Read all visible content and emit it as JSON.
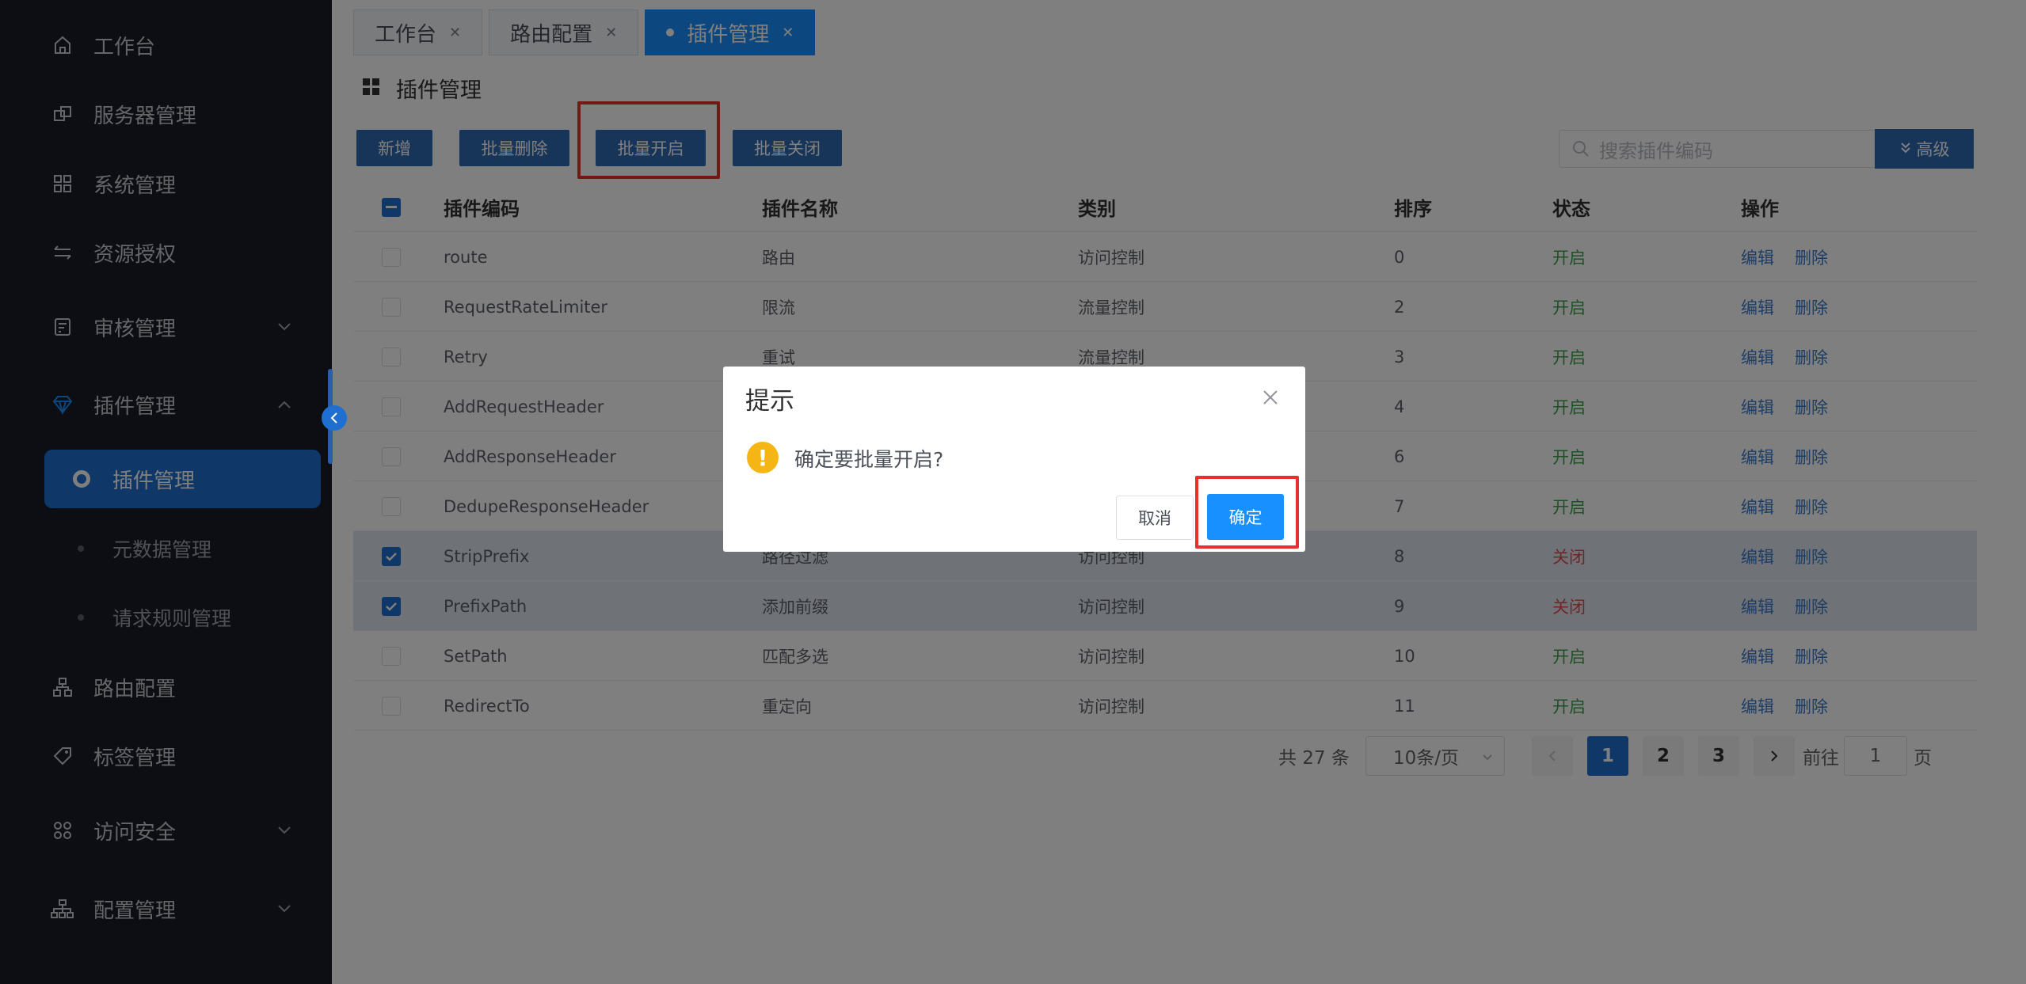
{
  "sidebar": {
    "items": [
      {
        "label": "工作台",
        "icon": "home-icon"
      },
      {
        "label": "服务器管理",
        "icon": "server-icon"
      },
      {
        "label": "系统管理",
        "icon": "grid-icon"
      },
      {
        "label": "资源授权",
        "icon": "transfer-icon"
      },
      {
        "label": "审核管理",
        "icon": "audit-icon"
      },
      {
        "label": "插件管理",
        "icon": "diamond-icon"
      },
      {
        "label": "路由配置",
        "icon": "route-icon"
      },
      {
        "label": "标签管理",
        "icon": "tag-icon"
      },
      {
        "label": "访问安全",
        "icon": "security-icon"
      },
      {
        "label": "配置管理",
        "icon": "config-icon"
      }
    ],
    "active_sub": "插件管理",
    "subs": [
      "元数据管理",
      "请求规则管理"
    ]
  },
  "tabs": [
    {
      "label": "工作台"
    },
    {
      "label": "路由配置"
    },
    {
      "label": "插件管理"
    }
  ],
  "page_title": "插件管理",
  "toolbar": {
    "add": "新增",
    "batch_delete": "批量删除",
    "batch_enable": "批量开启",
    "batch_disable": "批量关闭",
    "search_placeholder": "搜索插件编码",
    "advanced": "高级"
  },
  "table": {
    "headers": [
      "插件编码",
      "插件名称",
      "类别",
      "排序",
      "状态",
      "操作"
    ],
    "rows": [
      {
        "code": "route",
        "name": "路由",
        "category": "访问控制",
        "sort": "0",
        "status": "开启",
        "on": true,
        "checked": false
      },
      {
        "code": "RequestRateLimiter",
        "name": "限流",
        "category": "流量控制",
        "sort": "2",
        "status": "开启",
        "on": true,
        "checked": false
      },
      {
        "code": "Retry",
        "name": "重试",
        "category": "流量控制",
        "sort": "3",
        "status": "开启",
        "on": true,
        "checked": false
      },
      {
        "code": "AddRequestHeader",
        "name": "",
        "category": "",
        "sort": "4",
        "status": "开启",
        "on": true,
        "checked": false
      },
      {
        "code": "AddResponseHeader",
        "name": "",
        "category": "",
        "sort": "6",
        "status": "开启",
        "on": true,
        "checked": false
      },
      {
        "code": "DedupeResponseHeader",
        "name": "",
        "category": "",
        "sort": "7",
        "status": "开启",
        "on": true,
        "checked": false
      },
      {
        "code": "StripPrefix",
        "name": "路径过滤",
        "category": "访问控制",
        "sort": "8",
        "status": "关闭",
        "on": false,
        "checked": true
      },
      {
        "code": "PrefixPath",
        "name": "添加前缀",
        "category": "访问控制",
        "sort": "9",
        "status": "关闭",
        "on": false,
        "checked": true
      },
      {
        "code": "SetPath",
        "name": "匹配多选",
        "category": "访问控制",
        "sort": "10",
        "status": "开启",
        "on": true,
        "checked": false
      },
      {
        "code": "RedirectTo",
        "name": "重定向",
        "category": "访问控制",
        "sort": "11",
        "status": "开启",
        "on": true,
        "checked": false
      }
    ],
    "edit_label": "编辑",
    "delete_label": "删除"
  },
  "pager": {
    "total": "共 27 条",
    "size": "10条/页",
    "pages": [
      "1",
      "2",
      "3"
    ],
    "goto_label": "前往",
    "goto_value": "1",
    "page_suffix": "页"
  },
  "dialog": {
    "title": "提示",
    "message": "确定要批量开启?",
    "cancel": "取消",
    "confirm": "确定"
  },
  "colors": {
    "sidebar_bg": "#1a1d26",
    "primary": "#1890ff",
    "button": "#2f6bb3",
    "highlight": "#e8302d",
    "status_on": "#3aa24a",
    "status_off": "#e34a4a"
  }
}
